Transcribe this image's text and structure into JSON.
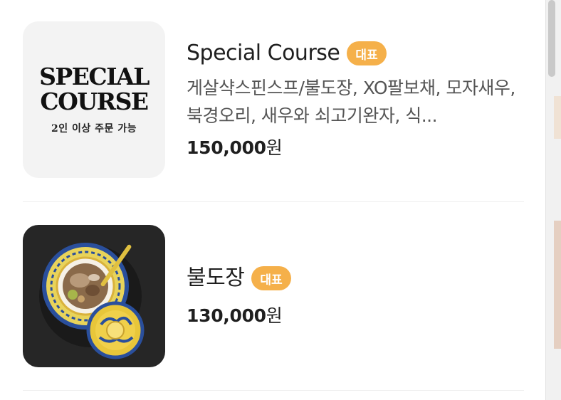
{
  "menu": {
    "items": [
      {
        "title": "Special Course",
        "badge": "대표",
        "description": "게살샥스핀스프/불도장, XO팔보채, 모자새우, 북경오리, 새우와 쇠고기완자, 식...",
        "price_amount": "150,000",
        "price_unit": "원",
        "thumb": {
          "line1": "SPECIAL",
          "line2": "COURSE",
          "sub": "2인 이상 주문 가능"
        }
      },
      {
        "title": "불도장",
        "badge": "대표",
        "price_amount": "130,000",
        "price_unit": "원"
      }
    ]
  },
  "colors": {
    "badge": "#f5b04a",
    "thumb_dark": "#262626",
    "thumb_light": "#f3f3f3"
  }
}
